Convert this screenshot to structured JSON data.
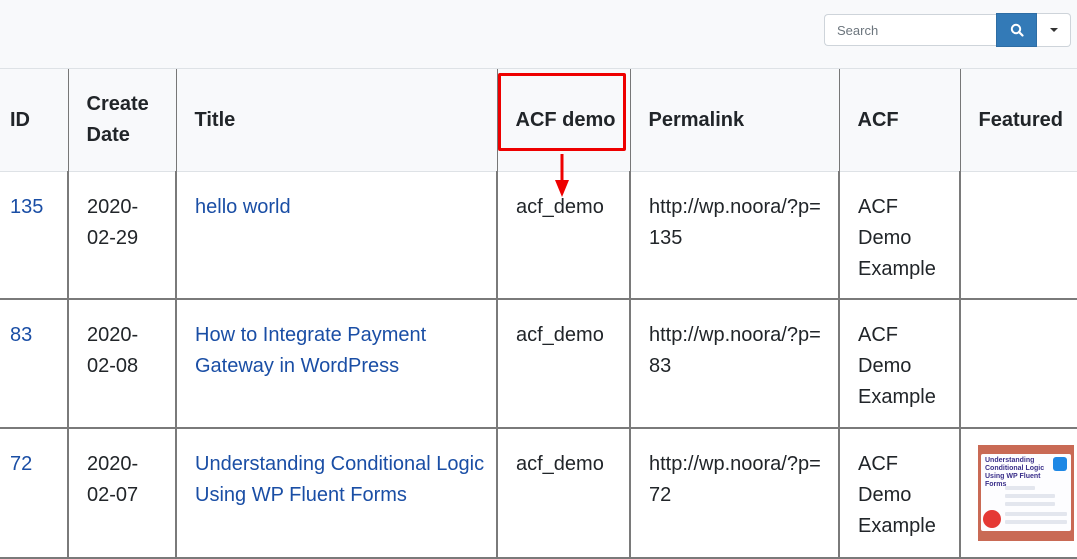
{
  "toolbar": {
    "search_placeholder": "Search",
    "search_value": "",
    "search_button_icon": "search-icon",
    "dropdown_icon": "caret-down-icon"
  },
  "table": {
    "columns": [
      {
        "key": "id",
        "label": "ID"
      },
      {
        "key": "create_date",
        "label": "Create Date"
      },
      {
        "key": "title",
        "label": "Title"
      },
      {
        "key": "acf_demo",
        "label": "ACF demo"
      },
      {
        "key": "permalink",
        "label": "Permalink"
      },
      {
        "key": "acf",
        "label": "ACF"
      },
      {
        "key": "featured",
        "label": "Featured"
      }
    ],
    "rows": [
      {
        "id": "135",
        "create_date": "2020-02-29",
        "title": "hello world",
        "acf_demo": "acf_demo",
        "permalink": "http://wp.noora/?p=135",
        "acf": "ACF Demo Example",
        "featured": ""
      },
      {
        "id": "83",
        "create_date": "2020-02-08",
        "title": "How to Integrate Payment Gateway in WordPress",
        "acf_demo": "acf_demo",
        "permalink": "http://wp.noora/?p=83",
        "acf": "ACF Demo Example",
        "featured": ""
      },
      {
        "id": "72",
        "create_date": "2020-02-07",
        "title": "Understanding Conditional Logic Using WP Fluent Forms",
        "acf_demo": "acf_demo",
        "permalink": "http://wp.noora/?p=72",
        "acf": "ACF Demo Example",
        "featured": "Understanding Conditional Logic Using WP Fluent Forms"
      }
    ]
  },
  "annotation": {
    "highlight_color": "#ee0000",
    "target_column": "ACF demo"
  },
  "colors": {
    "link": "#1a4ea5",
    "primary_button": "#337ab7",
    "header_bg": "#f8f9fb"
  }
}
